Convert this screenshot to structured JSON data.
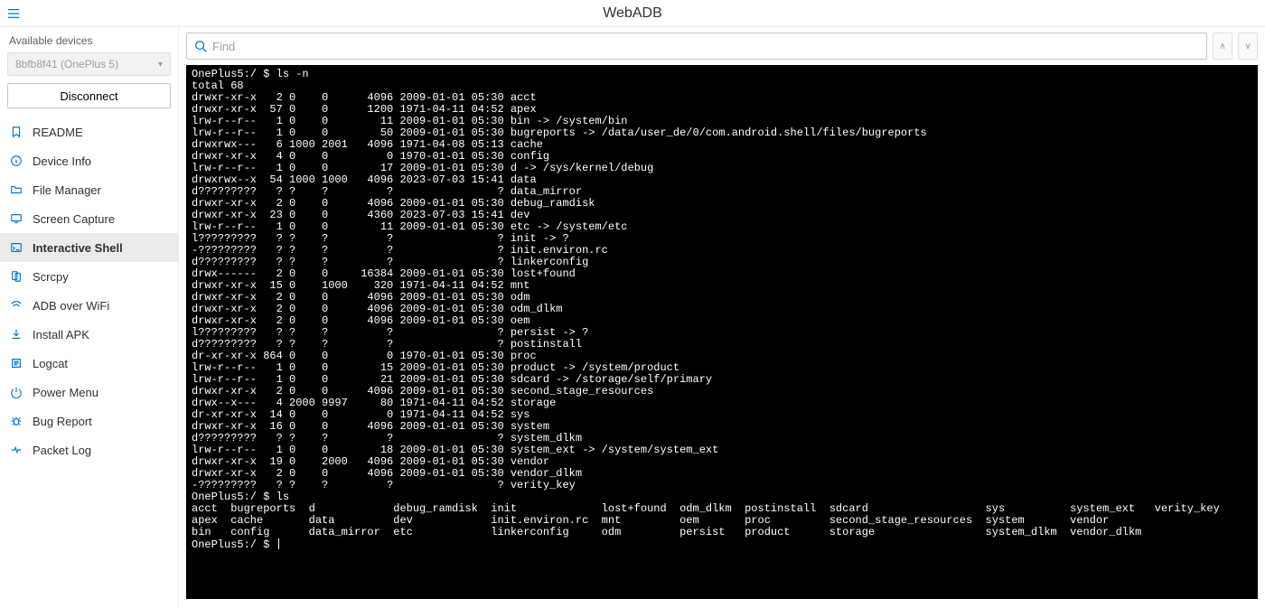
{
  "app": {
    "title": "WebADB"
  },
  "sidebar": {
    "available_label": "Available devices",
    "device_selected": "8bfb8f41 (OnePlus 5)",
    "disconnect_label": "Disconnect",
    "items": [
      {
        "icon": "bookmark",
        "label": "README"
      },
      {
        "icon": "info",
        "label": "Device Info"
      },
      {
        "icon": "folder",
        "label": "File Manager"
      },
      {
        "icon": "screen",
        "label": "Screen Capture"
      },
      {
        "icon": "shell",
        "label": "Interactive Shell"
      },
      {
        "icon": "mirror",
        "label": "Scrcpy"
      },
      {
        "icon": "wifi",
        "label": "ADB over WiFi"
      },
      {
        "icon": "install",
        "label": "Install APK"
      },
      {
        "icon": "log",
        "label": "Logcat"
      },
      {
        "icon": "power",
        "label": "Power Menu"
      },
      {
        "icon": "bug",
        "label": "Bug Report"
      },
      {
        "icon": "packet",
        "label": "Packet Log"
      }
    ],
    "active_index": 4
  },
  "find": {
    "placeholder": "Find"
  },
  "terminal": {
    "lines": [
      "OnePlus5:/ $ ls -n",
      "total 68",
      "drwxr-xr-x   2 0    0      4096 2009-01-01 05:30 acct",
      "drwxr-xr-x  57 0    0      1200 1971-04-11 04:52 apex",
      "lrw-r--r--   1 0    0        11 2009-01-01 05:30 bin -> /system/bin",
      "lrw-r--r--   1 0    0        50 2009-01-01 05:30 bugreports -> /data/user_de/0/com.android.shell/files/bugreports",
      "drwxrwx---   6 1000 2001   4096 1971-04-08 05:13 cache",
      "drwxr-xr-x   4 0    0         0 1970-01-01 05:30 config",
      "lrw-r--r--   1 0    0        17 2009-01-01 05:30 d -> /sys/kernel/debug",
      "drwxrwx--x  54 1000 1000   4096 2023-07-03 15:41 data",
      "d?????????   ? ?    ?         ?                ? data_mirror",
      "drwxr-xr-x   2 0    0      4096 2009-01-01 05:30 debug_ramdisk",
      "drwxr-xr-x  23 0    0      4360 2023-07-03 15:41 dev",
      "lrw-r--r--   1 0    0        11 2009-01-01 05:30 etc -> /system/etc",
      "l?????????   ? ?    ?         ?                ? init -> ?",
      "-?????????   ? ?    ?         ?                ? init.environ.rc",
      "d?????????   ? ?    ?         ?                ? linkerconfig",
      "drwx------   2 0    0     16384 2009-01-01 05:30 lost+found",
      "drwxr-xr-x  15 0    1000    320 1971-04-11 04:52 mnt",
      "drwxr-xr-x   2 0    0      4096 2009-01-01 05:30 odm",
      "drwxr-xr-x   2 0    0      4096 2009-01-01 05:30 odm_dlkm",
      "drwxr-xr-x   2 0    0      4096 2009-01-01 05:30 oem",
      "l?????????   ? ?    ?         ?                ? persist -> ?",
      "d?????????   ? ?    ?         ?                ? postinstall",
      "dr-xr-xr-x 864 0    0         0 1970-01-01 05:30 proc",
      "lrw-r--r--   1 0    0        15 2009-01-01 05:30 product -> /system/product",
      "lrw-r--r--   1 0    0        21 2009-01-01 05:30 sdcard -> /storage/self/primary",
      "drwxr-xr-x   2 0    0      4096 2009-01-01 05:30 second_stage_resources",
      "drwx--x---   4 2000 9997     80 1971-04-11 04:52 storage",
      "dr-xr-xr-x  14 0    0         0 1971-04-11 04:52 sys",
      "drwxr-xr-x  16 0    0      4096 2009-01-01 05:30 system",
      "d?????????   ? ?    ?         ?                ? system_dlkm",
      "lrw-r--r--   1 0    0        18 2009-01-01 05:30 system_ext -> /system/system_ext",
      "drwxr-xr-x  19 0    2000   4096 2009-01-01 05:30 vendor",
      "drwxr-xr-x   2 0    0      4096 2009-01-01 05:30 vendor_dlkm",
      "-?????????   ? ?    ?         ?                ? verity_key",
      "OnePlus5:/ $ ls",
      "acct  bugreports  d            debug_ramdisk  init             lost+found  odm_dlkm  postinstall  sdcard                  sys          system_ext   verity_key",
      "apex  cache       data         dev            init.environ.rc  mnt         oem       proc         second_stage_resources  system       vendor",
      "bin   config      data_mirror  etc            linkerconfig     odm         persist   product      storage                 system_dlkm  vendor_dlkm",
      "OnePlus5:/ $ "
    ]
  }
}
